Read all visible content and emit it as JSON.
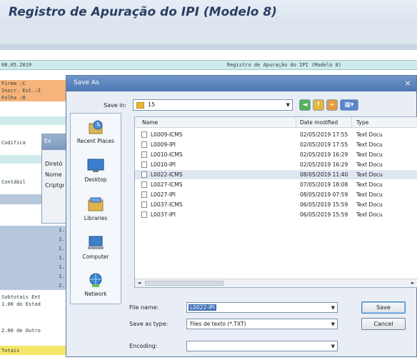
{
  "sap": {
    "title": "Registro de Apuração do IPI (Modelo 8)",
    "report_date": "08.05.2019",
    "report_title": "Registro de Apuração do IPI (Modelo 8)",
    "firma_label": "Firma      :C",
    "inscr_label": "Inscr. Est.:2",
    "folha_label": "Folha      :0",
    "codificacao_label": "Codifica",
    "contabil_label": "Contábil",
    "num_values": [
      "1.",
      "1.",
      "1.",
      "1.",
      "1.",
      "1.",
      "2."
    ],
    "subtotais_label": "Subtotais Ent",
    "estad_label": "1.00 do Estad",
    "outros_label": "2.00 de Outro",
    "totais_label": "Totais"
  },
  "mini_dialog": {
    "title": "Ex",
    "items": [
      "Diretó",
      "Nome",
      "Criptgr"
    ]
  },
  "dialog": {
    "title": "Save As",
    "close_glyph": "×",
    "save_in_label": "Save in:",
    "save_in_value": "15",
    "places": [
      {
        "label": "Recent Places",
        "icon": "recent-places-icon"
      },
      {
        "label": "Desktop",
        "icon": "desktop-icon"
      },
      {
        "label": "Libraries",
        "icon": "libraries-icon"
      },
      {
        "label": "Computer",
        "icon": "computer-icon"
      },
      {
        "label": "Network",
        "icon": "network-icon"
      }
    ],
    "columns": {
      "name": "Name",
      "date": "Date modified",
      "type": "Type"
    },
    "files": [
      {
        "name": "L0009-ICMS",
        "date": "02/05/2019 17:55",
        "type": "Text Docu"
      },
      {
        "name": "L0009-IPI",
        "date": "02/05/2019 17:55",
        "type": "Text Docu"
      },
      {
        "name": "L0010-ICMS",
        "date": "02/05/2019 16:29",
        "type": "Text Docu"
      },
      {
        "name": "L0010-IPI",
        "date": "02/05/2019 16:29",
        "type": "Text Docu"
      },
      {
        "name": "L0022-ICMS",
        "date": "08/05/2019 11:40",
        "type": "Text Docu"
      },
      {
        "name": "L0027-ICMS",
        "date": "07/05/2019 18:08",
        "type": "Text Docu"
      },
      {
        "name": "L0027-IPI",
        "date": "08/05/2019 07:59",
        "type": "Text Docu"
      },
      {
        "name": "L0037-ICMS",
        "date": "06/05/2019 15:59",
        "type": "Text Docu"
      },
      {
        "name": "L0037-IPI",
        "date": "06/05/2019 15:59",
        "type": "Text Docu"
      }
    ],
    "selected_index": 4,
    "file_name_label": "File name:",
    "file_name_value": "L0022-IPI",
    "save_type_label": "Save as type:",
    "save_type_value": "Files de texto (*.TXT)",
    "encoding_label": "Encoding:",
    "encoding_value": "",
    "save_button": "Save",
    "cancel_button": "Cancel",
    "scroll_left": "◄",
    "scroll_right": "►"
  }
}
